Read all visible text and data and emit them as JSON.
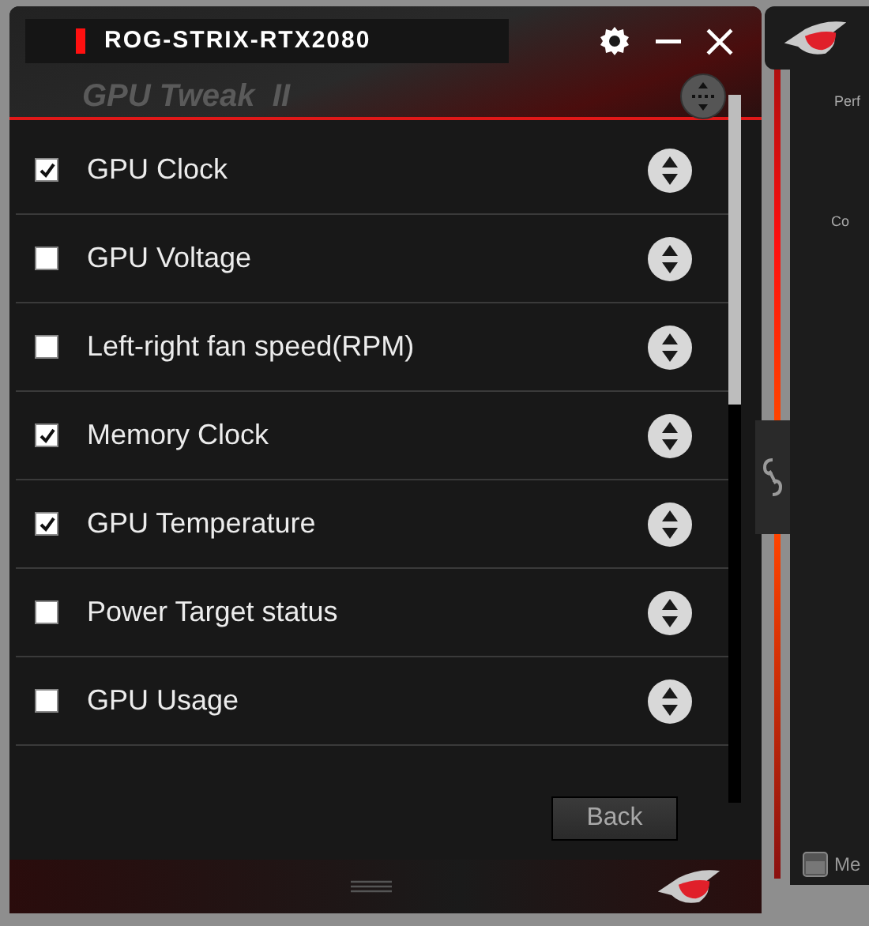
{
  "window": {
    "title": "ROG-STRIX-RTX2080",
    "brand": "GPU Tweak  II"
  },
  "items": [
    {
      "label": "GPU Clock",
      "checked": true
    },
    {
      "label": "GPU Voltage",
      "checked": false
    },
    {
      "label": "Left-right fan speed(RPM)",
      "checked": false
    },
    {
      "label": "Memory Clock",
      "checked": true
    },
    {
      "label": "GPU Temperature",
      "checked": true
    },
    {
      "label": "Power Target status",
      "checked": false
    },
    {
      "label": "GPU Usage",
      "checked": false
    }
  ],
  "back_button": "Back",
  "side_panel": {
    "texts": [
      "Perf",
      "Co"
    ],
    "bottom_label": "Me"
  }
}
